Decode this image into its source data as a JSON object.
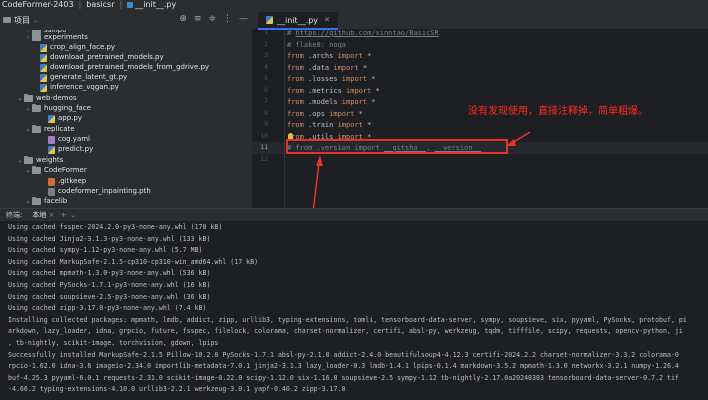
{
  "titlebar": {
    "project": "CodeFormer-2403",
    "folder": "basicsr",
    "file": "__init__.py"
  },
  "project_panel": {
    "title": "项目",
    "tools": [
      "⊕",
      "≡",
      "≑",
      "⋮",
      "—"
    ],
    "items": [
      {
        "label": "ssinpo",
        "type": "folder",
        "arrow": "›"
      },
      {
        "label": "experiments",
        "type": "folder",
        "arrow": "›"
      },
      {
        "label": "crop_align_face.py",
        "type": "py",
        "arrow": ""
      },
      {
        "label": "download_pretrained_models.py",
        "type": "py",
        "arrow": ""
      },
      {
        "label": "download_pretrained_models_from_gdrive.py",
        "type": "py",
        "arrow": ""
      },
      {
        "label": "generate_latent_gt.py",
        "type": "py",
        "arrow": ""
      },
      {
        "label": "inference_vqgan.py",
        "type": "py",
        "arrow": ""
      },
      {
        "label": "web-demos",
        "type": "folder",
        "arrow": "⌄"
      },
      {
        "label": "hugging_face",
        "type": "folder",
        "arrow": "⌄"
      },
      {
        "label": "app.py",
        "type": "py",
        "arrow": ""
      },
      {
        "label": "replicate",
        "type": "folder",
        "arrow": "⌄"
      },
      {
        "label": "cog.yaml",
        "type": "yaml",
        "arrow": ""
      },
      {
        "label": "predict.py",
        "type": "py",
        "arrow": ""
      },
      {
        "label": "weights",
        "type": "folder",
        "arrow": "⌄"
      },
      {
        "label": "CodeFormer",
        "type": "folder",
        "arrow": "⌄"
      },
      {
        "label": ".gitkeep",
        "type": "git",
        "arrow": ""
      },
      {
        "label": "codeformer_inpainting.pth",
        "type": "pth",
        "arrow": ""
      },
      {
        "label": "facelib",
        "type": "folder",
        "arrow": "⌄"
      }
    ]
  },
  "editor": {
    "tab_label": "__init__.py",
    "line_numbers": [
      "1",
      "2",
      "3",
      "4",
      "5",
      "6",
      "7",
      "8",
      "9",
      "10",
      "11",
      "12"
    ],
    "current_line": "11",
    "lines": [
      [
        {
          "c": "cm",
          "t": "# "
        },
        {
          "c": "url",
          "t": "https://github.com/xinntao/BasicSR"
        }
      ],
      [
        {
          "c": "cm",
          "t": "# flake8: noqa"
        }
      ],
      [
        {
          "c": "kw",
          "t": "from"
        },
        {
          "c": "tx",
          "t": " .archs "
        },
        {
          "c": "kw",
          "t": "import"
        },
        {
          "c": "tx",
          "t": " *"
        }
      ],
      [
        {
          "c": "kw",
          "t": "from"
        },
        {
          "c": "tx",
          "t": " .data "
        },
        {
          "c": "kw",
          "t": "import"
        },
        {
          "c": "tx",
          "t": " *"
        }
      ],
      [
        {
          "c": "kw",
          "t": "from"
        },
        {
          "c": "tx",
          "t": " .losses "
        },
        {
          "c": "kw",
          "t": "import"
        },
        {
          "c": "tx",
          "t": " *"
        }
      ],
      [
        {
          "c": "kw",
          "t": "from"
        },
        {
          "c": "tx",
          "t": " .metrics "
        },
        {
          "c": "kw",
          "t": "import"
        },
        {
          "c": "tx",
          "t": " *"
        }
      ],
      [
        {
          "c": "kw",
          "t": "from"
        },
        {
          "c": "tx",
          "t": " .models "
        },
        {
          "c": "kw",
          "t": "import"
        },
        {
          "c": "tx",
          "t": " *"
        }
      ],
      [
        {
          "c": "kw",
          "t": "from"
        },
        {
          "c": "tx",
          "t": " .ops "
        },
        {
          "c": "kw",
          "t": "import"
        },
        {
          "c": "tx",
          "t": " *"
        }
      ],
      [
        {
          "c": "kw",
          "t": "from"
        },
        {
          "c": "tx",
          "t": " .train "
        },
        {
          "c": "kw",
          "t": "import"
        },
        {
          "c": "tx",
          "t": " *"
        }
      ],
      [
        {
          "c": "kw",
          "t": "from"
        },
        {
          "c": "tx",
          "t": " .utils "
        },
        {
          "c": "kw",
          "t": "import"
        },
        {
          "c": "tx",
          "t": " *"
        }
      ],
      [
        {
          "c": "cm",
          "t": "# from .version import "
        },
        {
          "c": "cm-ul",
          "t": "__gitsha__"
        },
        {
          "c": "cm",
          "t": ", "
        },
        {
          "c": "cm-ul",
          "t": "__version__"
        }
      ],
      []
    ]
  },
  "annotation": {
    "text": "没有发现使用，直接注释掉，简单粗爆。",
    "color": "#ff2a1f"
  },
  "terminal_header": {
    "label": "终端:",
    "tab": "本地",
    "close": "×",
    "plus": "+",
    "chevron": "⌄"
  },
  "terminal": {
    "lines": [
      "Using cached fsspec-2024.2.0-py3-none-any.whl (170 kB)",
      "Using cached Jinja2-3.1.3-py3-none-any.whl (133 kB)",
      "Using cached sympy-1.12-py3-none-any.whl (5.7 MB)",
      "Using cached MarkupSafe-2.1.5-cp310-cp310-win_amd64.whl (17 kB)",
      "Using cached mpmath-1.3.0-py3-none-any.whl (536 kB)",
      "Using cached PySocks-1.7.1-py3-none-any.whl (16 kB)",
      "Using cached soupsieve-2.5-py3-none-any.whl (36 kB)",
      "Using cached zipp-3.17.0-py3-none-any.whl (7.4 kB)",
      "Installing collected packages: mpmath, lmdb, addict, zipp, urllib3, typing-extensions, tomli, tensorboard-data-server, sympy, soupsieve, six, pyyaml, PySocks, protobuf, pi",
      "arkdown, lazy_loader, idna, grpcio, future, fsspec, filelock, colorama, charset-normalizer, certifi, absl-py, werkzeug, tqdm, tifffile, scipy, requests, opencv-python, ji",
      ", tb-nightly, scikit-image, torchvision, gdown, lpips",
      "Successfully installed MarkupSafe-2.1.5 Pillow-10.2.0 PySocks-1.7.1 absl-py-2.1.0 addict-2.4.0 beautifulsoup4-4.12.3 certifi-2024.2.2 charset-normalizer-3.3.2 colorama-0",
      "rpcio-1.62.0 idna-3.6 imageio-2.34.0 importlib-metadata-7.0.1 jinja2-3.1.3 lazy_loader-0.3 lmdb-1.4.1 lpips-0.1.4 markdown-3.5.2 mpmath-1.3.0 networkx-3.2.1 numpy-1.26.4",
      "buf-4.25.3 pyyaml-6.0.1 requests-2.31.0 scikit-image-0.22.0 scipy-1.12.0 six-1.16.0 soupsieve-2.5 sympy-1.12 tb-nightly-2.17.0a20240303 tensorboard-data-server-0.7.2 tif",
      "-4.66.2 typing-extensions-4.10.0 urllib3-2.2.1 werkzeug-3.0.1 yapf-0.40.2 zipp-3.17.0"
    ]
  },
  "colors": {
    "accent": "#3574f0",
    "highlight_red": "#e5332a",
    "keyword": "#cf8e6d",
    "comment": "#7a7e85"
  }
}
